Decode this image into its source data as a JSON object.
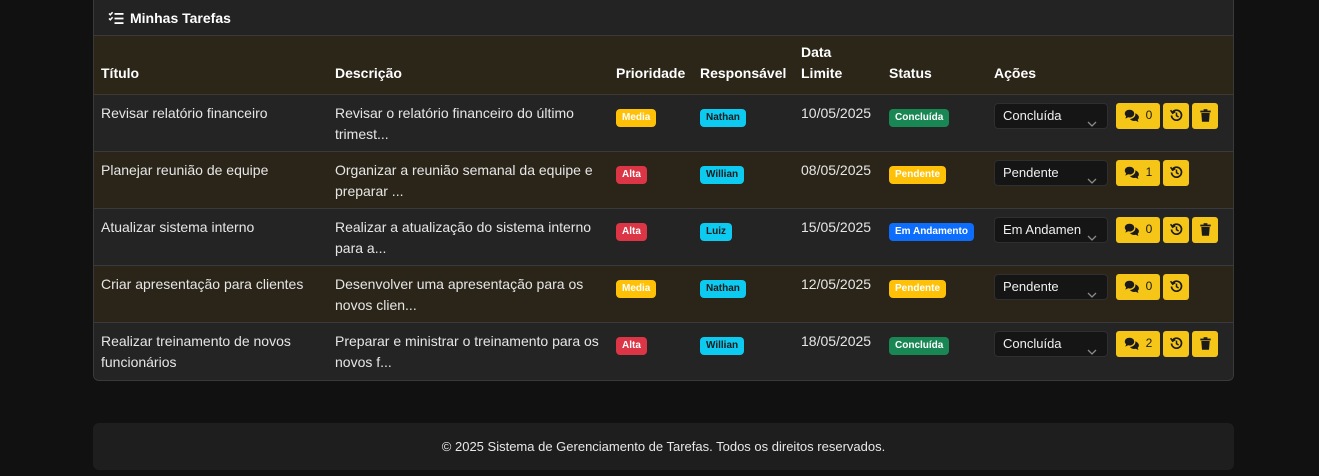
{
  "card": {
    "title": "Minhas Tarefas",
    "icon": "list-check-icon"
  },
  "table": {
    "headers": {
      "titulo": "Título",
      "descricao": "Descrição",
      "prioridade": "Prioridade",
      "responsavel": "Responsável",
      "data_limite_line1": "Data",
      "data_limite_line2": "Limite",
      "status": "Status",
      "acoes": "Ações"
    },
    "rows": [
      {
        "titulo": "Revisar relatório financeiro",
        "descricao": "Revisar o relatório financeiro do último trimest...",
        "prioridade": "Media",
        "responsavel": "Nathan",
        "data_limite": "10/05/2025",
        "status": "Concluída",
        "status_select": "Concluída",
        "comments": "0",
        "has_delete": true
      },
      {
        "titulo": "Planejar reunião de equipe",
        "descricao": "Organizar a reunião semanal da equipe e preparar ...",
        "prioridade": "Alta",
        "responsavel": "Willian",
        "data_limite": "08/05/2025",
        "status": "Pendente",
        "status_select": "Pendente",
        "comments": "1",
        "has_delete": false
      },
      {
        "titulo": "Atualizar sistema interno",
        "descricao": "Realizar a atualização do sistema interno para a...",
        "prioridade": "Alta",
        "responsavel": "Luiz",
        "data_limite": "15/05/2025",
        "status": "Em Andamento",
        "status_select": "Em Andamen",
        "comments": "0",
        "has_delete": true
      },
      {
        "titulo": "Criar apresentação para clientes",
        "descricao": "Desenvolver uma apresentação para os novos clien...",
        "prioridade": "Media",
        "responsavel": "Nathan",
        "data_limite": "12/05/2025",
        "status": "Pendente",
        "status_select": "Pendente",
        "comments": "0",
        "has_delete": false
      },
      {
        "titulo": "Realizar treinamento de novos funcionários",
        "descricao": "Preparar e ministrar o treinamento para os novos f...",
        "prioridade": "Alta",
        "responsavel": "Willian",
        "data_limite": "18/05/2025",
        "status": "Concluída",
        "status_select": "Concluída",
        "comments": "2",
        "has_delete": true
      }
    ]
  },
  "colors": {
    "priority": {
      "Media": "#ffc107",
      "Alta": "#dc3545"
    },
    "priority_text": {
      "Media": "#ffffff",
      "Alta": "#ffffff"
    },
    "responsavel": "#0dcaf0",
    "responsavel_text": "#1a1a1a",
    "status": {
      "Concluída": "#198754",
      "Pendente": "#ffc107",
      "Em Andamento": "#0d6efd"
    },
    "status_text": {
      "Concluída": "#ffffff",
      "Pendente": "#ffffff",
      "Em Andamento": "#ffffff"
    },
    "action_button": "#f5c518"
  },
  "icons": {
    "comments": "comments-icon",
    "history": "history-icon",
    "delete": "trash-icon",
    "select_arrow": "chevron-down-icon"
  },
  "footer": {
    "text": "© 2025 Sistema de Gerenciamento de Tarefas. Todos os direitos reservados."
  }
}
